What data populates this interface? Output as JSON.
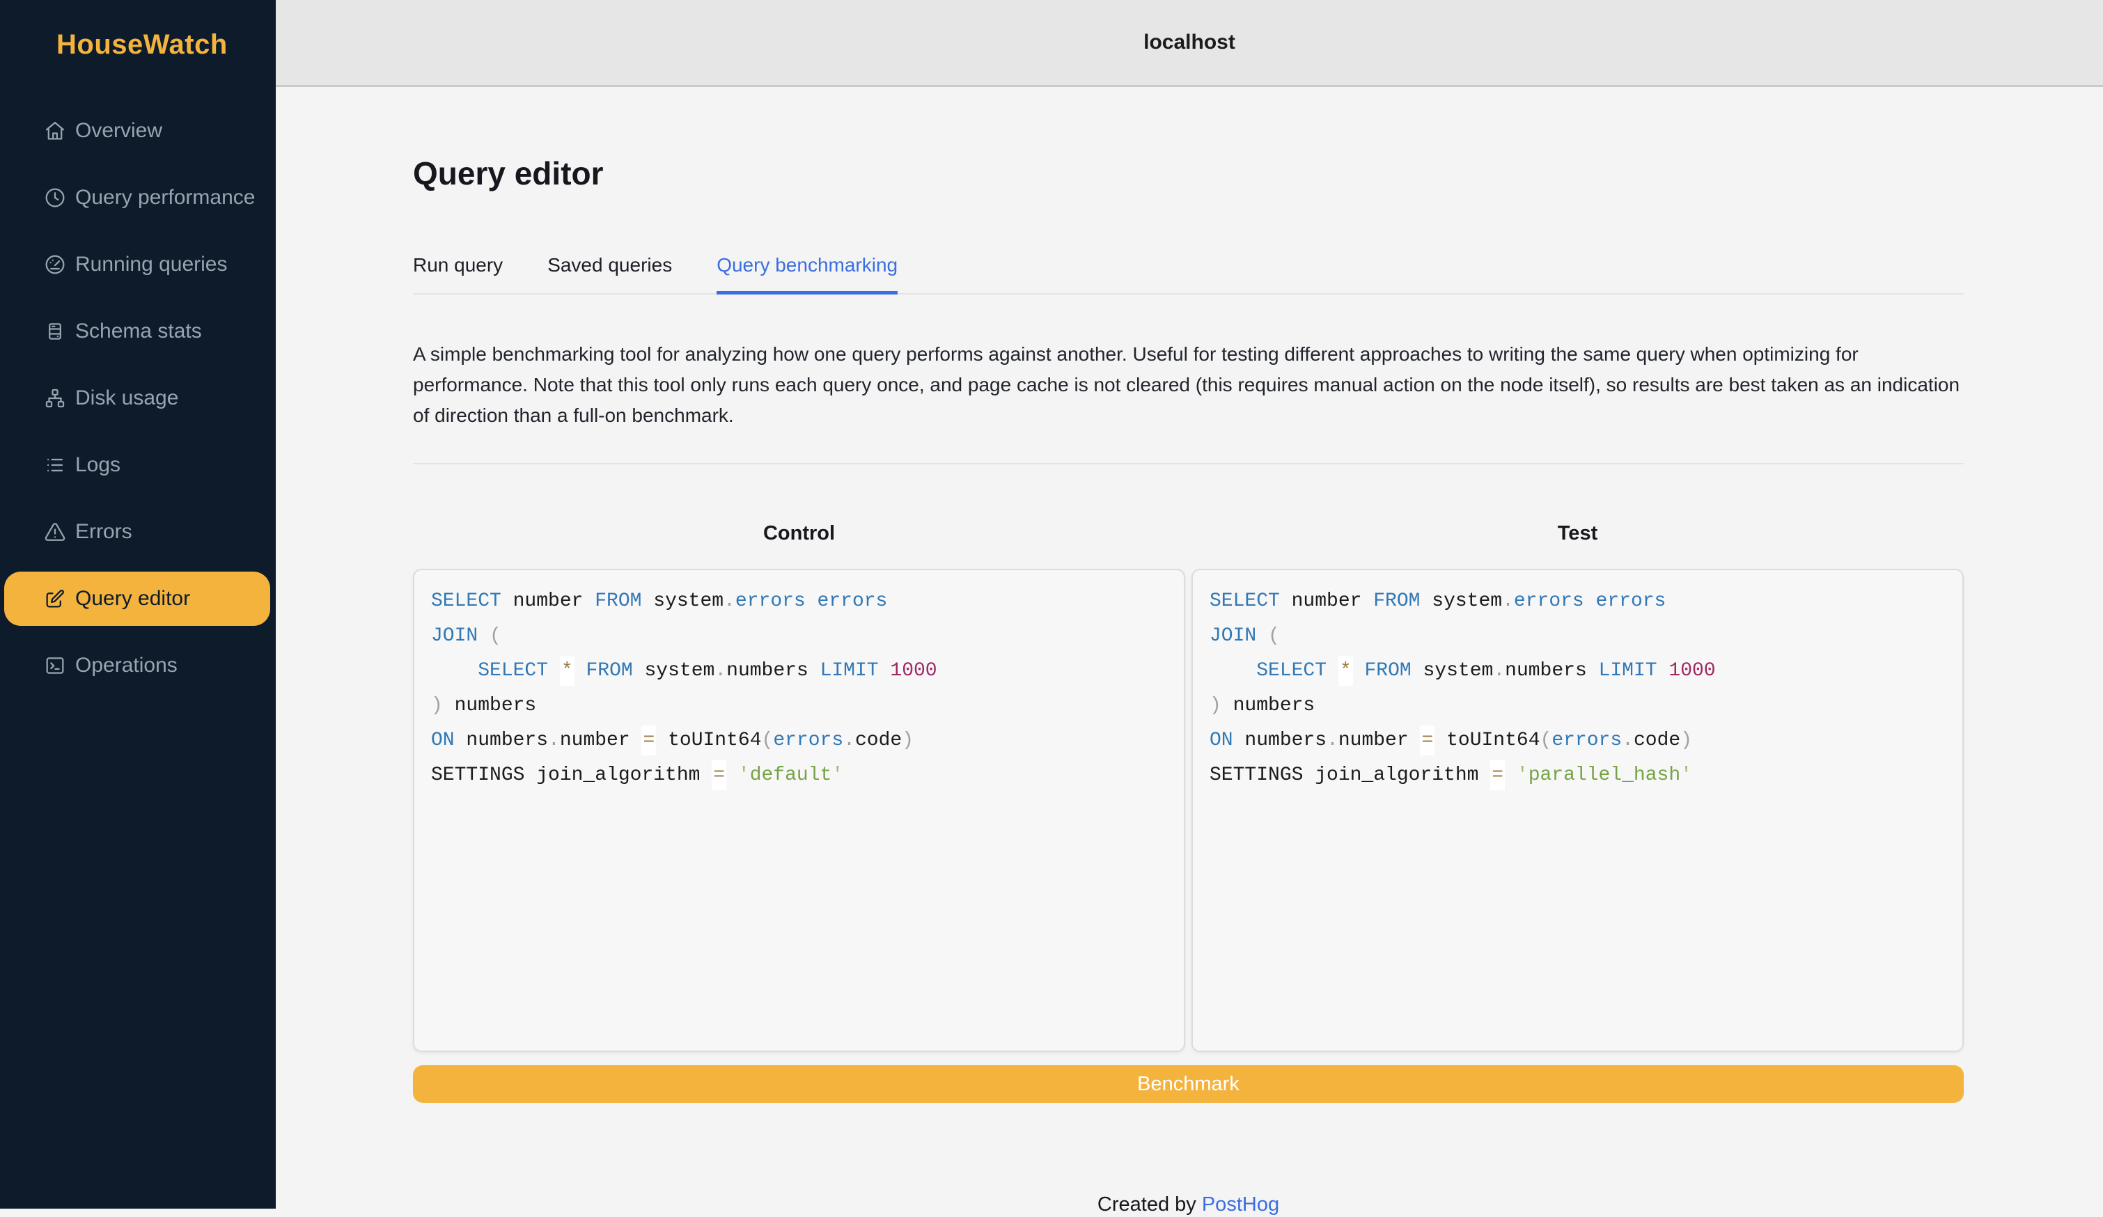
{
  "app": {
    "logo": "HouseWatch"
  },
  "header": {
    "host": "localhost"
  },
  "sidebar": {
    "items": [
      {
        "label": "Overview",
        "icon": "home-icon",
        "active": false
      },
      {
        "label": "Query performance",
        "icon": "clock-icon",
        "active": false
      },
      {
        "label": "Running queries",
        "icon": "gauge-icon",
        "active": false
      },
      {
        "label": "Schema stats",
        "icon": "server-icon",
        "active": false
      },
      {
        "label": "Disk usage",
        "icon": "sitemap-icon",
        "active": false
      },
      {
        "label": "Logs",
        "icon": "list-icon",
        "active": false
      },
      {
        "label": "Errors",
        "icon": "alert-triangle-icon",
        "active": false
      },
      {
        "label": "Query editor",
        "icon": "edit-icon",
        "active": true
      },
      {
        "label": "Operations",
        "icon": "terminal-icon",
        "active": false
      }
    ]
  },
  "page": {
    "title": "Query editor"
  },
  "tabs": [
    {
      "label": "Run query",
      "active": false
    },
    {
      "label": "Saved queries",
      "active": false
    },
    {
      "label": "Query benchmarking",
      "active": true
    }
  ],
  "description": "A simple benchmarking tool for analyzing how one query performs against another. Useful for testing different approaches to writing the same query when optimizing for performance. Note that this tool only runs each query once, and page cache is not cleared (this requires manual action on the node itself), so results are best taken as an indication of direction than a full-on benchmark.",
  "benchmark": {
    "button_label": "Benchmark",
    "columns": [
      {
        "label": "Control",
        "code_lines": [
          [
            [
              "k",
              "SELECT"
            ],
            [
              "t",
              " number "
            ],
            [
              "k",
              "FROM"
            ],
            [
              "t",
              " system"
            ],
            [
              "p",
              "."
            ],
            [
              "k",
              "errors"
            ],
            [
              "t",
              " "
            ],
            [
              "k",
              "errors"
            ]
          ],
          [
            [
              "k",
              "JOIN"
            ],
            [
              "t",
              " "
            ],
            [
              "p",
              "("
            ]
          ],
          [
            [
              "t",
              "    "
            ],
            [
              "k",
              "SELECT"
            ],
            [
              "t",
              " "
            ],
            [
              "o",
              "*"
            ],
            [
              "t",
              " "
            ],
            [
              "k",
              "FROM"
            ],
            [
              "t",
              " system"
            ],
            [
              "p",
              "."
            ],
            [
              "t",
              "numbers "
            ],
            [
              "k",
              "LIMIT"
            ],
            [
              "t",
              " "
            ],
            [
              "n",
              "1000"
            ]
          ],
          [
            [
              "p",
              ")"
            ],
            [
              "t",
              " numbers"
            ]
          ],
          [
            [
              "k",
              "ON"
            ],
            [
              "t",
              " numbers"
            ],
            [
              "p",
              "."
            ],
            [
              "t",
              "number "
            ],
            [
              "o",
              "="
            ],
            [
              "t",
              " toUInt64"
            ],
            [
              "p",
              "("
            ],
            [
              "k",
              "errors"
            ],
            [
              "p",
              "."
            ],
            [
              "t",
              "code"
            ],
            [
              "p",
              ")"
            ]
          ],
          [
            [
              "t",
              "SETTINGS join_algorithm "
            ],
            [
              "o",
              "="
            ],
            [
              "t",
              " "
            ],
            [
              "q",
              "'"
            ],
            [
              "s",
              "default"
            ],
            [
              "q",
              "'"
            ]
          ]
        ]
      },
      {
        "label": "Test",
        "code_lines": [
          [
            [
              "k",
              "SELECT"
            ],
            [
              "t",
              " number "
            ],
            [
              "k",
              "FROM"
            ],
            [
              "t",
              " system"
            ],
            [
              "p",
              "."
            ],
            [
              "k",
              "errors"
            ],
            [
              "t",
              " "
            ],
            [
              "k",
              "errors"
            ]
          ],
          [
            [
              "k",
              "JOIN"
            ],
            [
              "t",
              " "
            ],
            [
              "p",
              "("
            ]
          ],
          [
            [
              "t",
              "    "
            ],
            [
              "k",
              "SELECT"
            ],
            [
              "t",
              " "
            ],
            [
              "o",
              "*"
            ],
            [
              "t",
              " "
            ],
            [
              "k",
              "FROM"
            ],
            [
              "t",
              " system"
            ],
            [
              "p",
              "."
            ],
            [
              "t",
              "numbers "
            ],
            [
              "k",
              "LIMIT"
            ],
            [
              "t",
              " "
            ],
            [
              "n",
              "1000"
            ]
          ],
          [
            [
              "p",
              ")"
            ],
            [
              "t",
              " numbers"
            ]
          ],
          [
            [
              "k",
              "ON"
            ],
            [
              "t",
              " numbers"
            ],
            [
              "p",
              "."
            ],
            [
              "t",
              "number "
            ],
            [
              "o",
              "="
            ],
            [
              "t",
              " toUInt64"
            ],
            [
              "p",
              "("
            ],
            [
              "k",
              "errors"
            ],
            [
              "p",
              "."
            ],
            [
              "t",
              "code"
            ],
            [
              "p",
              ")"
            ]
          ],
          [
            [
              "t",
              "SETTINGS join_algorithm "
            ],
            [
              "o",
              "="
            ],
            [
              "t",
              " "
            ],
            [
              "q",
              "'"
            ],
            [
              "s",
              "parallel_hash"
            ],
            [
              "q",
              "'"
            ]
          ]
        ]
      }
    ]
  },
  "footer": {
    "created_by": "Created by ",
    "brand_link": "PostHog"
  },
  "colors": {
    "brand_amber": "#f4b33d",
    "accent_blue": "#3b6ee0",
    "sidebar_bg": "#0d1b2a",
    "sidebar_text": "#9aa3b0",
    "page_bg": "#f4f4f5",
    "header_bg": "#e6e6e6",
    "code_keyword": "#3178b5",
    "code_number": "#9e2a63",
    "code_string": "#76a343",
    "code_quote": "#a3bd72",
    "code_operator": "#9c7c45",
    "code_punct": "#a0a0a0"
  }
}
